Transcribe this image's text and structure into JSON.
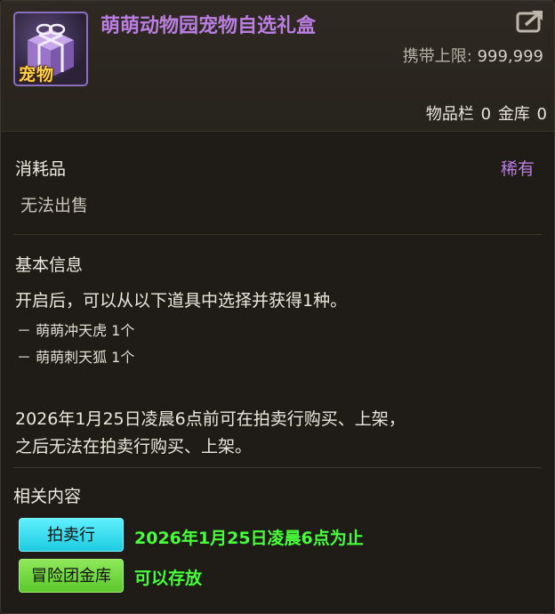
{
  "item": {
    "name": "萌萌动物园宠物自选礼盒",
    "icon_label": "宠物",
    "icon": "gift-box-icon",
    "carry_limit_label": "携带上限:",
    "carry_limit_value": "999,999",
    "inventory_label": "物品栏",
    "inventory_count": "0",
    "vault_label": "金库",
    "vault_count": "0",
    "type": "消耗品",
    "rarity": "稀有",
    "sell_status": "无法出售"
  },
  "basic_info": {
    "heading": "基本信息",
    "description": "开启后，可以从以下道具中选择并获得1种。",
    "rewards": [
      "－ 萌萌冲天虎 1个",
      "－ 萌萌刺天狐 1个"
    ],
    "notice_line1": "2026年1月25日凌晨6点前可在拍卖行购买、上架，",
    "notice_line2": "之后无法在拍卖行购买、上架。"
  },
  "related": {
    "heading": "相关内容",
    "auction_button": "拍卖行",
    "auction_info": "2026年1月25日凌晨6点为止",
    "warehouse_button": "冒险团金库",
    "warehouse_info": "可以存放"
  },
  "colors": {
    "title_purple": "#b97ee0",
    "info_green": "#46ff3a",
    "auction_cyan": "#1ecbe0",
    "warehouse_green": "#5cc82c"
  }
}
